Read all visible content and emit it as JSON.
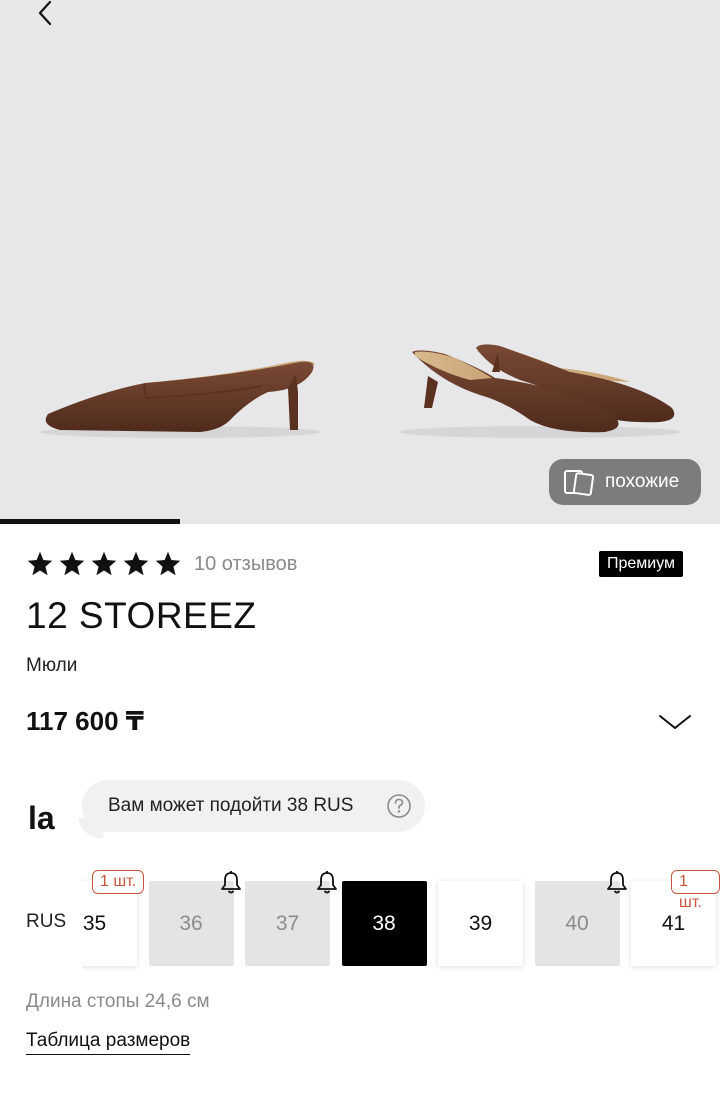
{
  "colors": {
    "accent": "#000000",
    "stock_tag": "#c8553d",
    "muted_text": "#8a8a8a",
    "image_bg": "#e7e7e9",
    "unavailable_bg": "#e4e4e6"
  },
  "gallery": {
    "back_icon": "chevron-left-icon",
    "similar_label": "похожие",
    "similar_icon": "cards-icon",
    "progress_fraction": 0.25
  },
  "rating": {
    "stars": 5,
    "reviews_label": "10 отзывов"
  },
  "badge": "Премиум",
  "brand": "12 STOREEZ",
  "product_type": "Мюли",
  "price": "117 600 ₸",
  "fit": {
    "logo": "la",
    "text": "Вам может подойти 38 RUS",
    "help_icon": "question-circle-icon"
  },
  "sizes": {
    "system": "RUS",
    "items": [
      {
        "label": "35",
        "state": "available",
        "stock": "1 шт.",
        "notify": false
      },
      {
        "label": "36",
        "state": "unavailable",
        "stock": "",
        "notify": true
      },
      {
        "label": "37",
        "state": "unavailable",
        "stock": "",
        "notify": true
      },
      {
        "label": "38",
        "state": "selected",
        "stock": "",
        "notify": false
      },
      {
        "label": "39",
        "state": "available",
        "stock": "",
        "notify": false
      },
      {
        "label": "40",
        "state": "unavailable",
        "stock": "",
        "notify": true
      },
      {
        "label": "41",
        "state": "available",
        "stock": "1 шт.",
        "notify": false
      }
    ]
  },
  "foot_length": "Длина стопы 24,6 см",
  "size_table_link": "Таблица размеров"
}
